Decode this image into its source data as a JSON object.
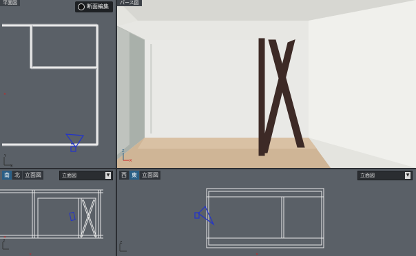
{
  "plan_view": {
    "label": "平面図",
    "section_edit_label": "断面編集"
  },
  "perspective_view": {
    "label": "パース図"
  },
  "elevation_left": {
    "tabs": [
      "南",
      "北",
      "立面図"
    ],
    "active_tab": 0,
    "dropdown_value": "立面図"
  },
  "elevation_right": {
    "tabs": [
      "西",
      "東",
      "立面図"
    ],
    "active_tab": 1,
    "dropdown_value": "立面図"
  },
  "axis_labels": {
    "y": "Y",
    "x": "X"
  },
  "colors": {
    "panel_bg": "#5a6067",
    "wall_line": "#e8e8e8",
    "camera": "#2233cc",
    "axis_red": "#cc2222",
    "tab_active": "#2a5f86"
  },
  "icons": {
    "dropdown_arrow": "chevron-down-icon",
    "section_toggle": "circle-toggle-icon"
  }
}
